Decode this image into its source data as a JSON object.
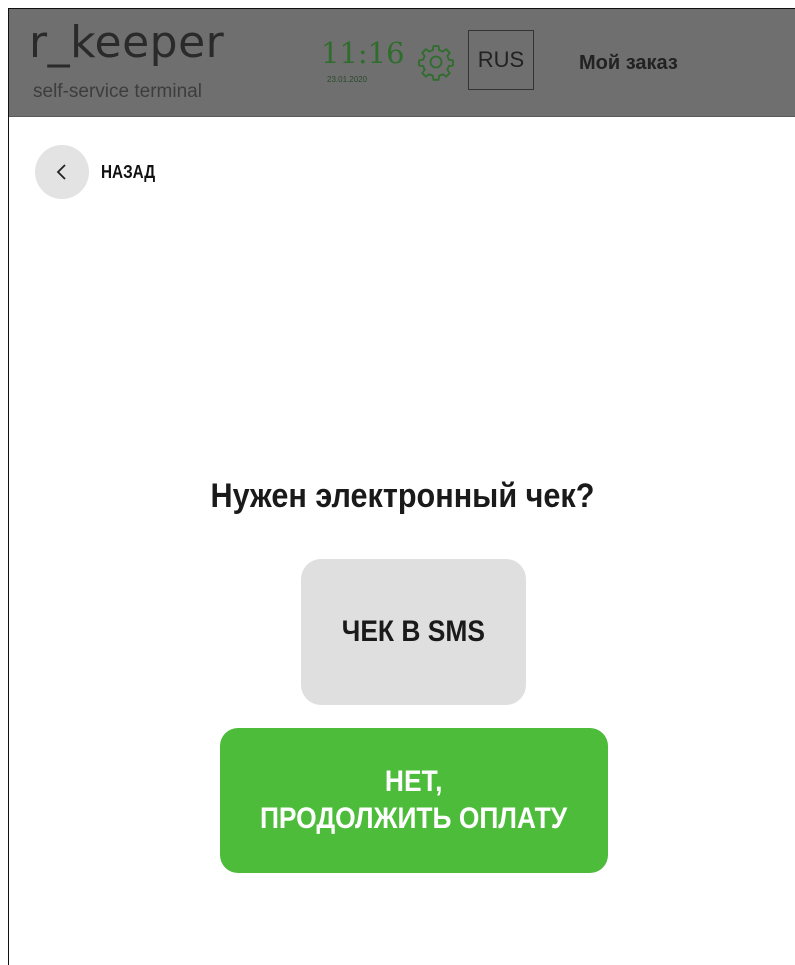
{
  "header": {
    "logo_main": "r_keeper",
    "logo_sub": "self-service terminal",
    "time": "11:16",
    "date": "23.01.2020",
    "settings_icon": "gear-icon",
    "language": "RUS",
    "my_order": "Мой заказ"
  },
  "nav": {
    "back_icon": "chevron-left-icon",
    "back_label": "НАЗАД"
  },
  "main": {
    "question": "Нужен электронный чек?",
    "sms_button": "ЧЕК В SMS",
    "continue_line1": "НЕТ,",
    "continue_line2": "ПРОДОЛЖИТЬ ОПЛАТУ"
  },
  "colors": {
    "header_bg": "#6f6f6f",
    "accent_green": "#4cbc3a",
    "secondary_button": "#dfdfdf",
    "clock_green": "#2f6d2c"
  }
}
